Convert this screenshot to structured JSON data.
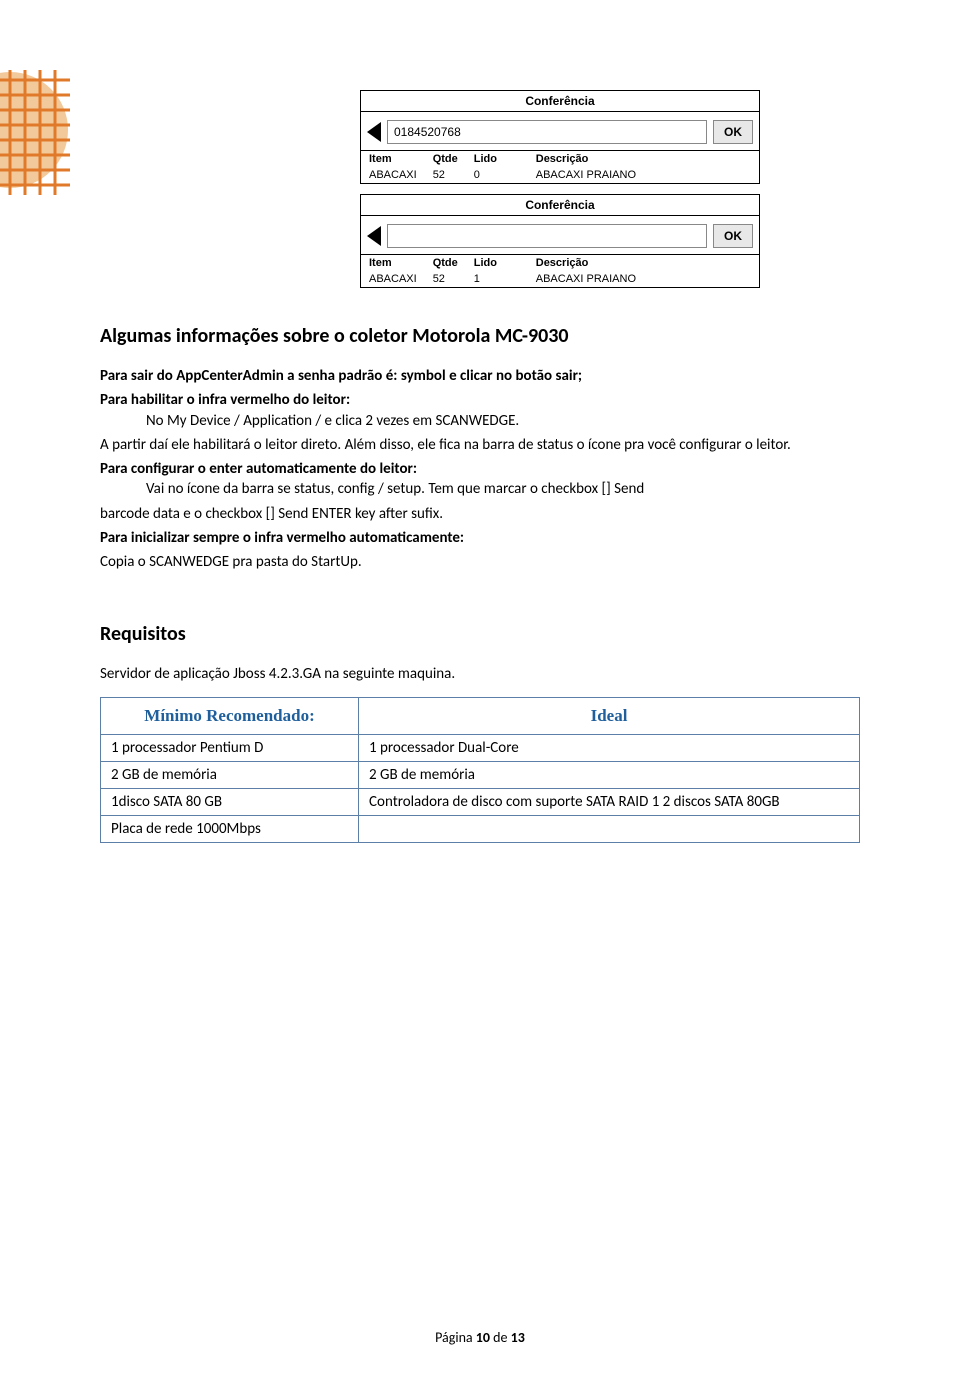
{
  "conf": {
    "title": "Conferência",
    "ok": "OK",
    "headers": [
      "Item",
      "Qtde",
      "Lido",
      "Descrição"
    ],
    "block1": {
      "input": "0184520768",
      "row": [
        "ABACAXI",
        "52",
        "0",
        "ABACAXI PRAIANO"
      ]
    },
    "block2": {
      "input": "",
      "row": [
        "ABACAXI",
        "52",
        "1",
        "ABACAXI PRAIANO"
      ]
    }
  },
  "section1_title": "Algumas informações sobre o coletor Motorola MC-9030",
  "p1_bold": "Para sair do AppCenterAdmin a senha padrão é: symbol e clicar no botão sair;",
  "p2_bold": "Para habilitar o infra vermelho do leitor:",
  "p2_indent": "No My Device / Application / e clica 2 vezes em SCANWEDGE.",
  "p2_cont1": "A partir daí ele habilitará o leitor direto. Além disso, ele fica na barra de status o ícone pra você configurar o leitor.",
  "p3_bold": "Para configurar o enter automaticamente do leitor:",
  "p3_indent": "Vai no ícone da barra se status, config / setup. Tem que marcar o checkbox [] Send",
  "p3_cont": "barcode data e o checkbox [] Send ENTER key after sufix.",
  "p4_bold": "Para inicializar sempre o infra vermelho automaticamente:",
  "p4_text": "Copia o SCANWEDGE pra pasta do StartUp.",
  "section2_title": "Requisitos",
  "req_intro": "Servidor de aplicação Jboss 4.2.3.GA na seguinte maquina.",
  "req_table": {
    "h1": "Mínimo Recomendado:",
    "h2": "Ideal",
    "rows": [
      [
        "1 processador Pentium D",
        "1 processador Dual-Core"
      ],
      [
        "2 GB de memória",
        "2 GB de memória"
      ],
      [
        "1disco SATA 80 GB",
        "Controladora de disco com suporte SATA RAID 1 2 discos SATA 80GB"
      ],
      [
        "Placa de rede 1000Mbps",
        ""
      ]
    ]
  },
  "footer": {
    "prefix": "Página ",
    "num": "10",
    "mid": " de ",
    "total": "13"
  }
}
